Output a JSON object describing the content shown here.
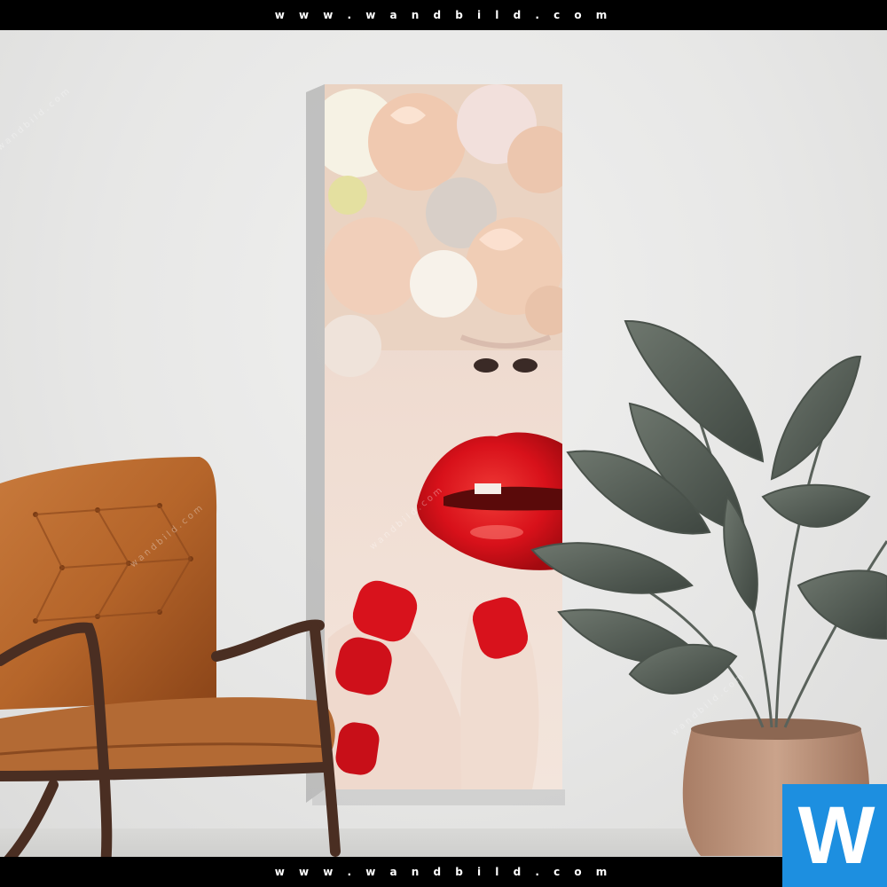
{
  "header": {
    "site_text": "w w w . w a n d b i l d . c o m"
  },
  "footer": {
    "site_text": "w w w . w a n d b i l d . c o m"
  },
  "logo": {
    "letter": "W",
    "color": "#1d8fe0"
  },
  "scene": {
    "wall_color": "#e8e8e7",
    "chair_color": "#b5652a",
    "lip_color": "#d8111a",
    "nail_color": "#d8121c",
    "plant_color": "#59625a",
    "pot_color": "#c49b82"
  }
}
